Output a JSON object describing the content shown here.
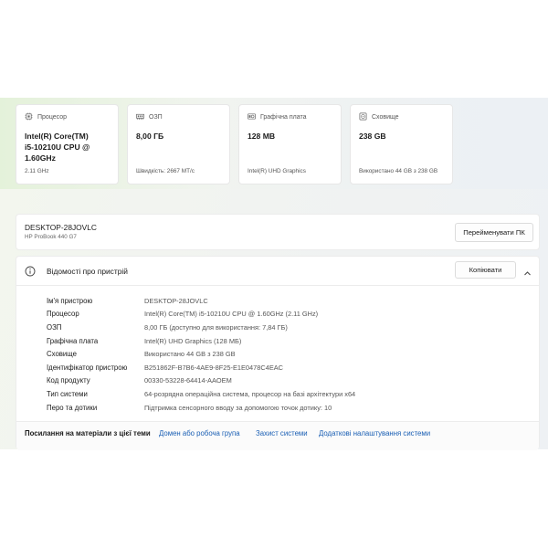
{
  "cards": [
    {
      "label": "Процесор",
      "value_lines": [
        "Intel(R) Core(TM)",
        "i5-10210U CPU @",
        "1.60GHz"
      ],
      "sub": "2.11 GHz",
      "icon": "cpu-icon"
    },
    {
      "label": "ОЗП",
      "value_lines": [
        "8,00 ГБ"
      ],
      "sub": "Швидкість: 2667 МТ/с",
      "icon": "ram-icon"
    },
    {
      "label": "Графічна плата",
      "value_lines": [
        "128 MB"
      ],
      "sub": "Intel(R) UHD Graphics",
      "icon": "gpu-icon"
    },
    {
      "label": "Сховище",
      "value_lines": [
        "238 GB"
      ],
      "sub": "Використано 44 GB з 238 GB",
      "icon": "storage-icon"
    }
  ],
  "device": {
    "name": "DESKTOP-28JOVLC",
    "model": "HP ProBook 440 G7",
    "rename_label": "Перейменувати ПК"
  },
  "specs": {
    "title": "Відомості про пристрій",
    "copy_label": "Копіювати",
    "rows": [
      {
        "key": "Ім'я пристрою",
        "value": "DESKTOP-28JOVLC"
      },
      {
        "key": "Процесор",
        "value": "Intel(R) Core(TM) i5-10210U CPU @ 1.60GHz (2.11 GHz)"
      },
      {
        "key": "ОЗП",
        "value": "8,00 ГБ (доступно для використання: 7,84 ГБ)"
      },
      {
        "key": "Графічна плата",
        "value": "Intel(R) UHD Graphics (128 МБ)"
      },
      {
        "key": "Сховище",
        "value": "Використано 44 GB з 238 GB"
      },
      {
        "key": "Ідентифікатор пристрою",
        "value": "B251862F-B7B6-4AE9-8F25-E1E0478C4EAC"
      },
      {
        "key": "Код продукту",
        "value": "00330-53228-64414-AAOEM"
      },
      {
        "key": "Тип системи",
        "value": "64-розрядна операційна система, процесор на базі архітектури x64"
      },
      {
        "key": "Перо та дотики",
        "value": "Підтримка сенсорного вводу за допомогою точок дотику: 10"
      }
    ]
  },
  "related": {
    "label": "Посилання на матеріали з цієї теми",
    "links": [
      "Домен або робоча група",
      "Захист системи",
      "Додаткові налаштування системи"
    ]
  },
  "colors": {
    "link": "#1a5fb4",
    "accent_bg": "#f3f6ee"
  }
}
